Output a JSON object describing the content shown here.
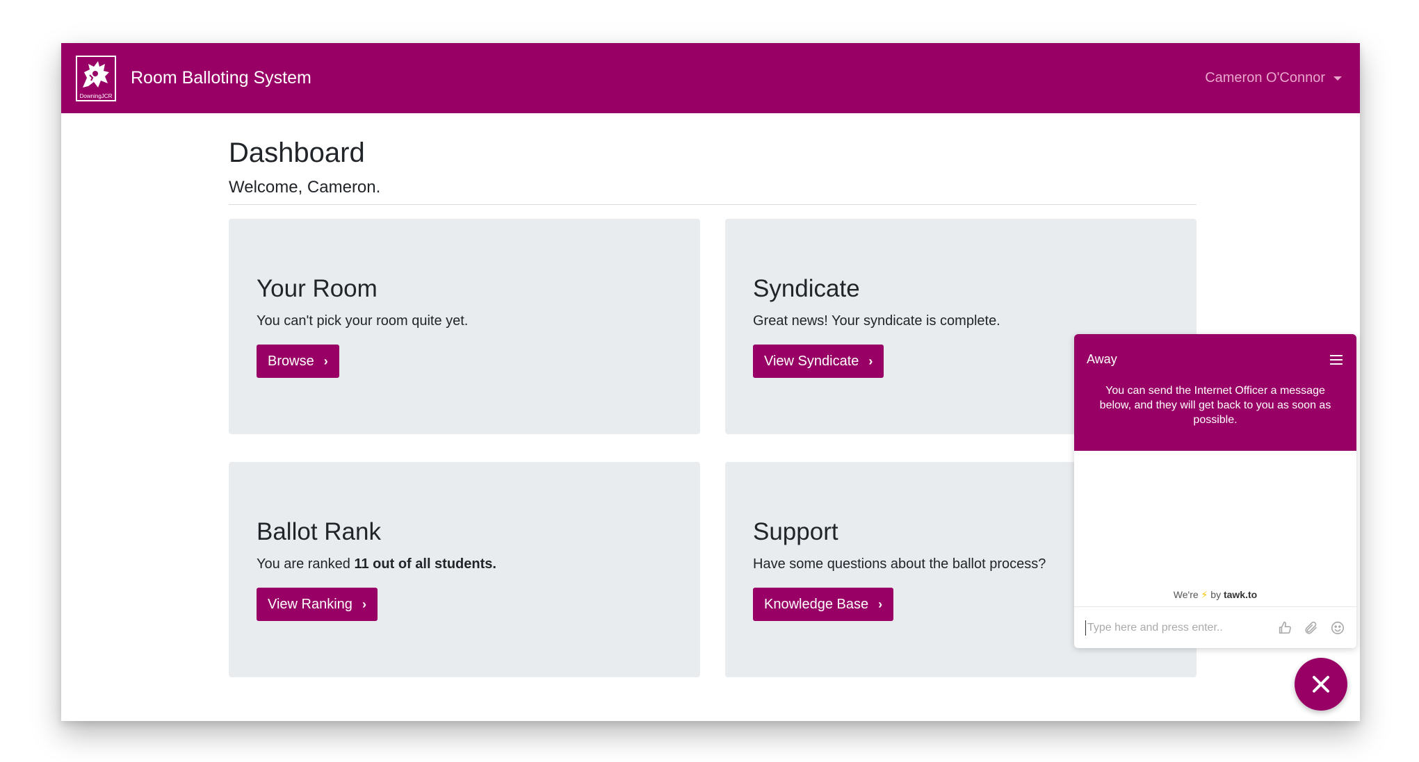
{
  "navbar": {
    "logo_text": "DowningJCR",
    "title": "Room Balloting System",
    "user_name": "Cameron O'Connor"
  },
  "page": {
    "title": "Dashboard",
    "welcome": "Welcome, Cameron."
  },
  "cards": {
    "room": {
      "title": "Your Room",
      "text": "You can't pick your room quite yet.",
      "button": "Browse"
    },
    "syndicate": {
      "title": "Syndicate",
      "text": "Great news! Your syndicate is complete.",
      "button": "View Syndicate"
    },
    "ballot": {
      "title": "Ballot Rank",
      "text_prefix": "You are ranked ",
      "text_bold": "11 out of all students.",
      "button": "View Ranking"
    },
    "support": {
      "title": "Support",
      "text": "Have some questions about the ballot process?",
      "button": "Knowledge Base"
    }
  },
  "chat": {
    "status": "Away",
    "message": "You can send the Internet Officer a message below, and they will get back to you as soon as possible.",
    "powered_prefix": "We're",
    "powered_by": "by",
    "powered_brand": "tawk.to",
    "input_placeholder": "Type here and press enter.."
  },
  "colors": {
    "brand": "#990066",
    "card_bg": "#e9ecef",
    "user_menu": "#e9a6cc"
  }
}
